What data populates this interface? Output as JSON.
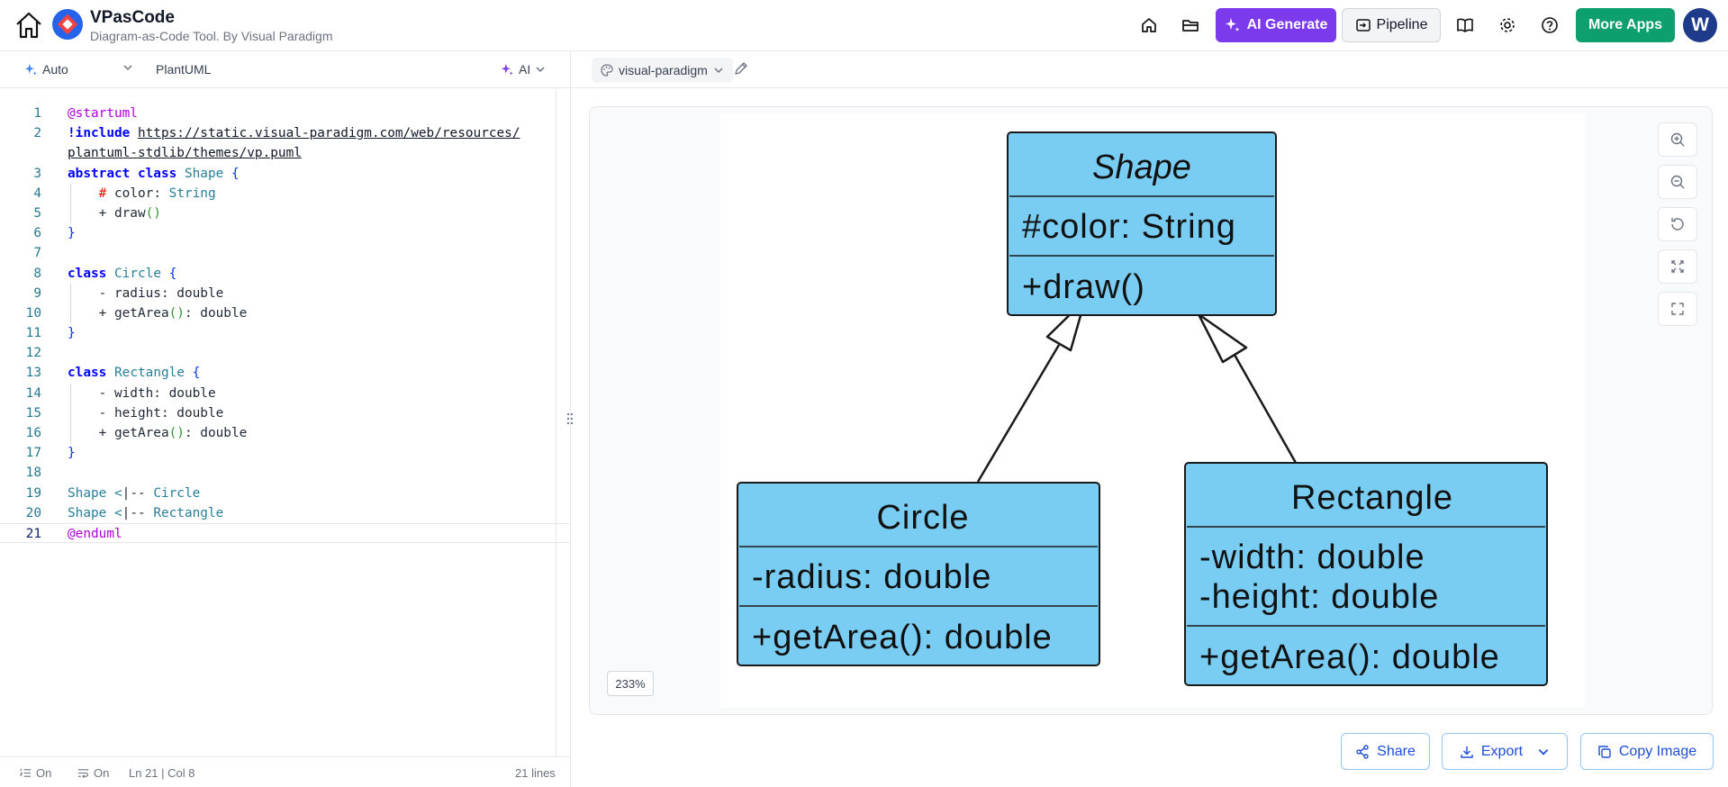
{
  "header": {
    "app_name": "VPasCode",
    "app_subtitle": "Diagram-as-Code Tool. By Visual Paradigm",
    "ai_generate_label": "AI Generate",
    "pipeline_label": "Pipeline",
    "more_apps_label": "More Apps",
    "avatar_initial": "W",
    "colors": {
      "ai": "#7c3aed",
      "more_apps": "#0e9f6e",
      "avatar": "#1e3a8a"
    }
  },
  "editor": {
    "mode_label": "Auto",
    "language_label": "PlantUML",
    "ai_label": "AI",
    "lines": {
      "l1": "@startuml",
      "l2a": "!include",
      "l2b": "https://static.visual-paradigm.com/web/resources/",
      "l2c": "plantuml-stdlib/themes/vp.puml",
      "l3a": "abstract class",
      "l3b": "Shape",
      "l3c": "{",
      "l4a": "#",
      "l4b": "color:",
      "l4c": "String",
      "l5a": "+ draw",
      "l5b": "()",
      "l6": "}",
      "l8a": "class",
      "l8b": "Circle",
      "l8c": "{",
      "l9": "- radius: double",
      "l10a": "+ getArea",
      "l10b": "()",
      "l10c": ": double",
      "l11": "}",
      "l13a": "class",
      "l13b": "Rectangle",
      "l13c": "{",
      "l14": "- width: double",
      "l15": "- height: double",
      "l16a": "+ getArea",
      "l16b": "()",
      "l16c": ": double",
      "l17": "}",
      "l19a": "Shape <",
      "l19b": "|-- ",
      "l19c": "Circle",
      "l20a": "Shape <",
      "l20b": "|-- ",
      "l20c": "Rectangle",
      "l21": "@enduml"
    },
    "line_numbers": [
      "1",
      "2",
      "3",
      "4",
      "5",
      "6",
      "7",
      "8",
      "9",
      "10",
      "11",
      "12",
      "13",
      "14",
      "15",
      "16",
      "17",
      "18",
      "19",
      "20",
      "21"
    ]
  },
  "status": {
    "wrap_label": "On",
    "format_label": "On",
    "cursor": "Ln 21 | Col 8",
    "line_count": "21 lines"
  },
  "preview": {
    "theme_label": "visual-paradigm",
    "zoom": "233%",
    "share_label": "Share",
    "export_label": "Export",
    "copy_label": "Copy Image"
  },
  "diagram": {
    "fill_color": "#79cdf3",
    "shape": {
      "name": "Shape",
      "attr": "#color: String",
      "method": "+draw()"
    },
    "circle": {
      "name": "Circle",
      "attr": "-radius: double",
      "method": "+getArea(): double"
    },
    "rectangle": {
      "name": "Rectangle",
      "attr1": "-width: double",
      "attr2": "-height: double",
      "method": "+getArea(): double"
    }
  }
}
